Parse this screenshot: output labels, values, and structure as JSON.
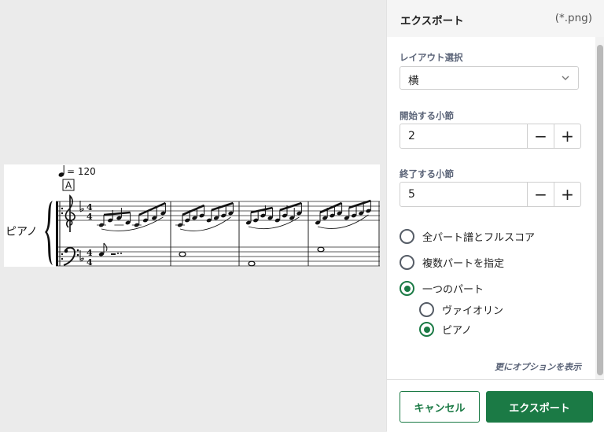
{
  "preview": {
    "tempo": "= 120",
    "rehearsal_mark": "A",
    "instrument": "ピアノ"
  },
  "panel": {
    "title": "エクスポート",
    "extension": "(*.png)",
    "layout": {
      "label": "レイアウト選択",
      "value": "横"
    },
    "start_measure": {
      "label": "開始する小節",
      "value": "2",
      "minus": "−",
      "plus": "+"
    },
    "end_measure": {
      "label": "終了する小節",
      "value": "5",
      "minus": "−",
      "plus": "+"
    },
    "options": [
      {
        "label": "全パート譜とフルスコア",
        "checked": false
      },
      {
        "label": "複数パートを指定",
        "checked": false
      },
      {
        "label": "一つのパート",
        "checked": true
      }
    ],
    "parts": [
      {
        "label": "ヴァイオリン",
        "checked": false
      },
      {
        "label": "ピアノ",
        "checked": true
      }
    ],
    "more_options": "更にオプションを表示",
    "cancel": "キャンセル",
    "export": "エクスポート"
  },
  "colors": {
    "accent": "#1b7a45",
    "label": "#5b6478"
  }
}
